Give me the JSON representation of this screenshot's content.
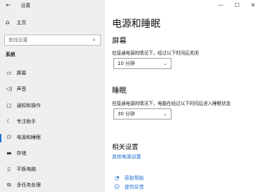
{
  "window": {
    "app_title": "设置",
    "controls": {
      "minimize": "—",
      "maximize": "☐",
      "close": "✕"
    }
  },
  "sidebar": {
    "home_label": "主页",
    "search_placeholder": "查找设置",
    "section_title": "系统",
    "items": [
      {
        "label": "屏幕",
        "icon": "display-icon"
      },
      {
        "label": "声音",
        "icon": "speaker-icon"
      },
      {
        "label": "通知和操作",
        "icon": "notification-icon"
      },
      {
        "label": "专注助手",
        "icon": "moon-icon"
      },
      {
        "label": "电源和睡眠",
        "icon": "power-icon",
        "selected": true
      },
      {
        "label": "存储",
        "icon": "storage-icon"
      },
      {
        "label": "平板电脑",
        "icon": "tablet-icon"
      },
      {
        "label": "多任务处理",
        "icon": "multitask-icon"
      }
    ]
  },
  "main": {
    "page_title": "电源和睡眠",
    "screen": {
      "heading": "屏幕",
      "description": "在接通电源的情况下，经过以下时间后关闭",
      "value": "10 分钟"
    },
    "sleep": {
      "heading": "睡眠",
      "description": "在接通电源的情况下，电脑在经过以下时间后进入睡眠状态",
      "value": "30 分钟"
    },
    "related": {
      "heading": "相关设置",
      "link": "其他电源设置"
    },
    "help": {
      "get_help": "获取帮助",
      "feedback": "提供反馈"
    }
  }
}
